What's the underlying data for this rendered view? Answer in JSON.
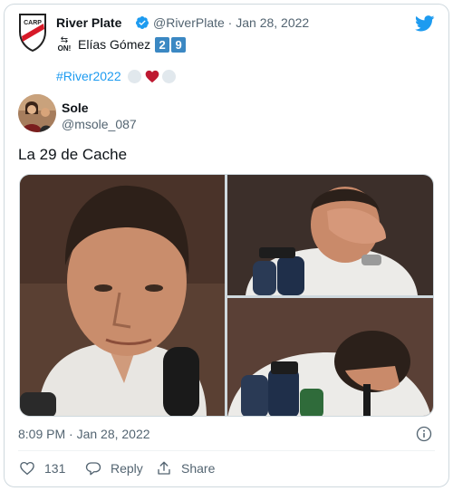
{
  "quoted": {
    "name": "River Plate",
    "handle_date": "@RiverPlate · Jan 28, 2022",
    "line2_text": "Elías Gómez",
    "line2_numbers": [
      "2",
      "9"
    ],
    "on_icon_text": "ON!",
    "hashtag": "#River2022"
  },
  "reply": {
    "name": "Sole",
    "handle": "@msole_087",
    "text": "La 29 de Cache"
  },
  "footer": {
    "time": "8:09 PM · Jan 28, 2022",
    "like_count": "131",
    "reply_label": "Reply",
    "share_label": "Share"
  },
  "icons": {
    "verified": "verified-badge-icon",
    "bird": "twitter-bird-icon",
    "info": "info-icon",
    "like": "heart-icon",
    "reply": "reply-bubble-icon",
    "share": "share-icon"
  },
  "colors": {
    "accent": "#1d9bf0",
    "text": "#0f1419",
    "muted": "#536471",
    "border": "#cfd9de",
    "heart": "#be1931",
    "number_box": "#3b88c3"
  }
}
